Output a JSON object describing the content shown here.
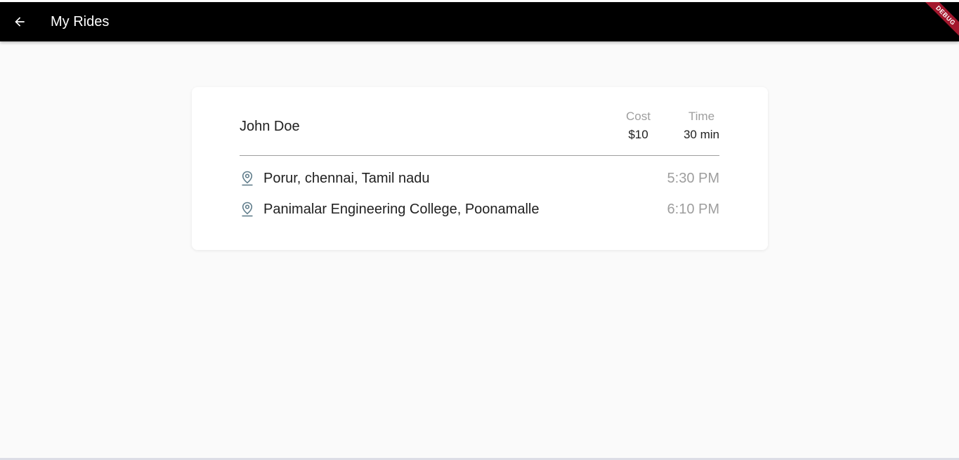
{
  "appbar": {
    "title": "My Rides",
    "back_icon": "arrow-back-icon",
    "background": "#000000"
  },
  "debug_banner": {
    "label": "DEBUG",
    "color": "#a3172d"
  },
  "ride": {
    "rider_name": "John Doe",
    "cost": {
      "label": "Cost",
      "value": "$10"
    },
    "time": {
      "label": "Time",
      "value": "30 min"
    },
    "stops": [
      {
        "icon": "location-pin-icon",
        "place": "Porur, chennai, Tamil nadu",
        "time": "5:30 PM"
      },
      {
        "icon": "location-pin-icon",
        "place": "Panimalar Engineering College, Poonamalle",
        "time": "6:10 PM"
      }
    ]
  }
}
